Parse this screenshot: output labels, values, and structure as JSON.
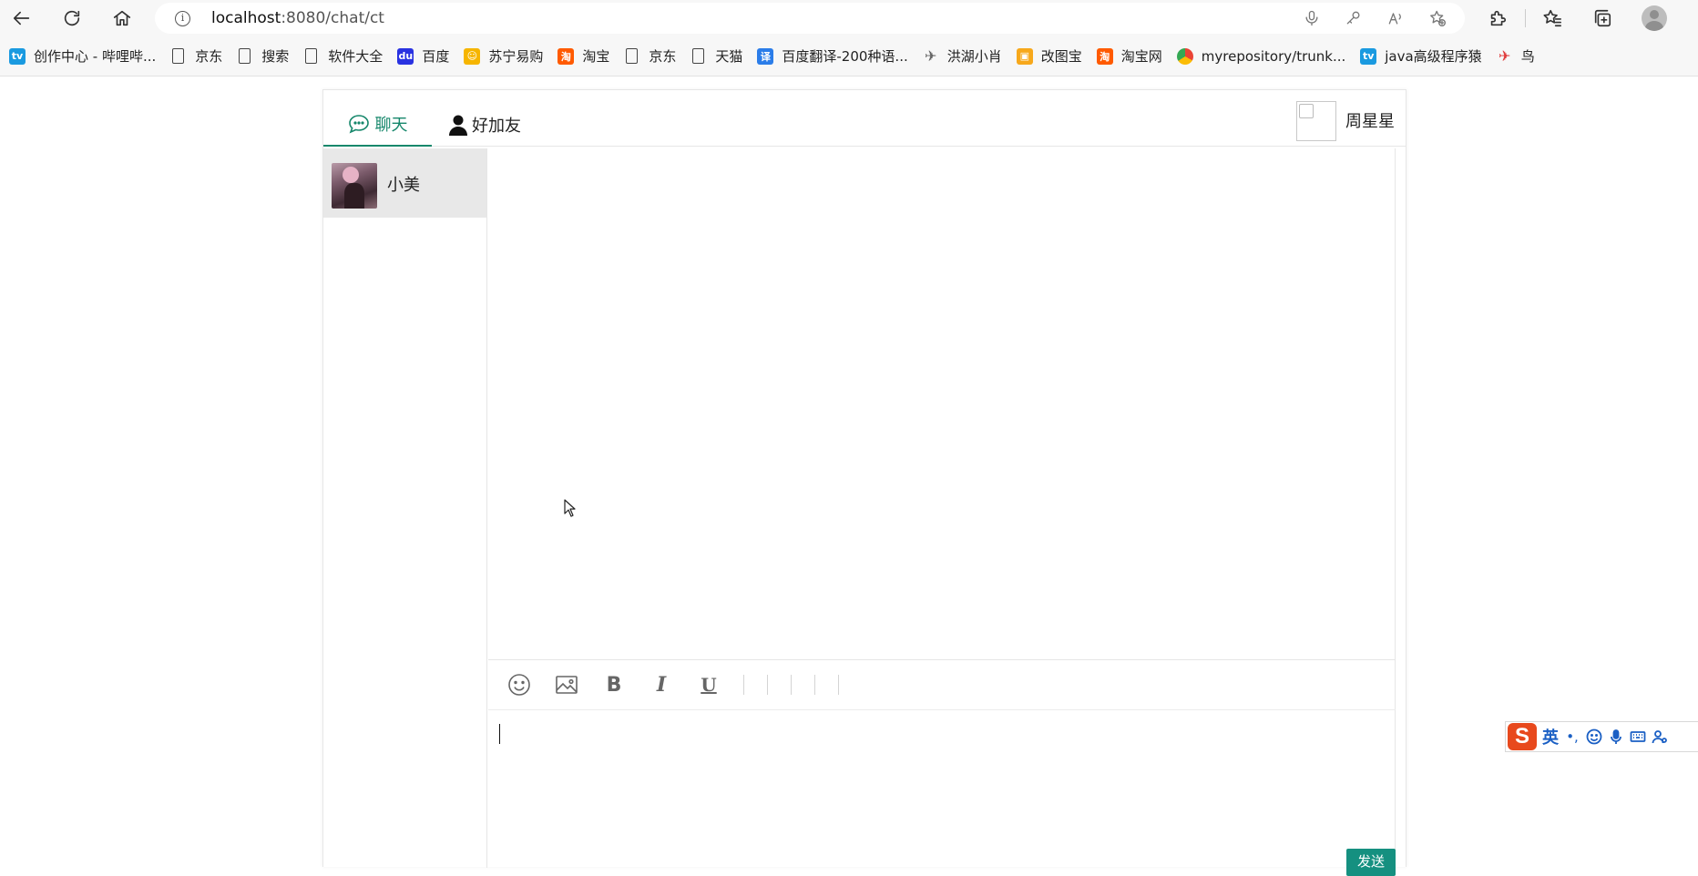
{
  "browser": {
    "address": {
      "host": "localhost",
      "rest": ":8080/chat/ct"
    },
    "bookmarks": [
      {
        "label": "创作中心 - 哔哩哔...",
        "icon": "bilibili-icon",
        "color": "#1a9ae0"
      },
      {
        "label": "京东",
        "icon": "page-icon",
        "color": ""
      },
      {
        "label": "搜索",
        "icon": "page-icon",
        "color": ""
      },
      {
        "label": "软件大全",
        "icon": "page-icon",
        "color": ""
      },
      {
        "label": "百度",
        "icon": "baidu-icon",
        "color": "#2932e1"
      },
      {
        "label": "苏宁易购",
        "icon": "suning-icon",
        "color": "#f6b500"
      },
      {
        "label": "淘宝",
        "icon": "taobao-icon",
        "color": "#ff5a00"
      },
      {
        "label": "京东",
        "icon": "page-icon",
        "color": ""
      },
      {
        "label": "天猫",
        "icon": "page-icon",
        "color": ""
      },
      {
        "label": "百度翻译-200种语...",
        "icon": "baidu-translate-icon",
        "color": "#2b7de9"
      },
      {
        "label": "洪湖小肖",
        "icon": "bird-icon",
        "color": "#666666"
      },
      {
        "label": "改图宝",
        "icon": "gaitubao-icon",
        "color": "#f7a81b"
      },
      {
        "label": "淘宝网",
        "icon": "taobao-icon",
        "color": "#ff5a00"
      },
      {
        "label": "myrepository/trunk...",
        "icon": "chrome-icon",
        "color": "#34a853"
      },
      {
        "label": "java高级程序猿",
        "icon": "bilibili-icon",
        "color": "#1a9ae0"
      },
      {
        "label": "鸟",
        "icon": "bird-red-icon",
        "color": "#e03c3c"
      }
    ]
  },
  "app": {
    "tabs": {
      "chat": "聊天",
      "friends": "好加友"
    },
    "user": {
      "name": "周星星"
    },
    "contacts": [
      {
        "name": "小美"
      }
    ],
    "editor": {
      "value": ""
    },
    "send_label": "发送"
  },
  "ime": {
    "mode": "英"
  },
  "colors": {
    "accent": "#16876b",
    "send": "#159080",
    "ime": "#1a5fc4"
  }
}
